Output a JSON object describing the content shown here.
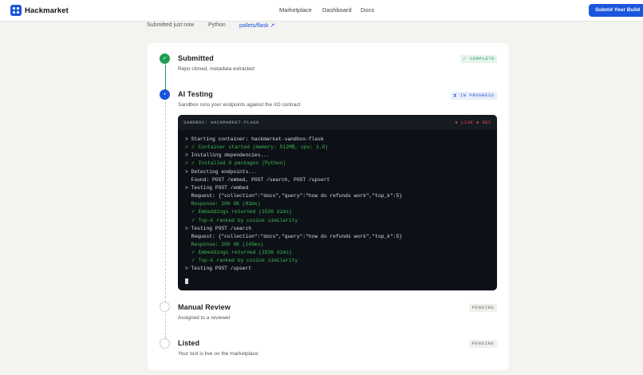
{
  "app": {
    "name": "Hackmarket"
  },
  "nav": {
    "items": [
      "Marketplace",
      "Dashboard",
      "Docs"
    ],
    "cta": "Submit Your Build"
  },
  "meta": {
    "submitted": "Submitted just now",
    "sep": "·",
    "language": "Python",
    "repo": "pallets/flask ↗"
  },
  "steps": [
    {
      "title": "Submitted",
      "desc": "Repo cloned, metadata extracted",
      "status": "✓ COMPLETE",
      "icon": "✓"
    },
    {
      "title": "AI Testing",
      "desc": "Sandbox runs your endpoints against the I/O contract",
      "status": "IN PROGRESS",
      "icon": "•"
    },
    {
      "title": "Manual Review",
      "desc": "Assigned to a reviewer",
      "status": "PENDING",
      "icon": ""
    },
    {
      "title": "Listed",
      "desc": "Your tool is live on the marketplace",
      "status": "PENDING",
      "icon": ""
    }
  ],
  "terminal": {
    "title": "SANDBOX: HACKMARKET-FLASK",
    "flags": "● LIVE  ● REC",
    "lines": [
      {
        "text": "> Starting container: hackmarket-sandbox-flask",
        "ok": false
      },
      {
        "text": "> ✓ Container started (memory: 512MB, cpu: 1.0)",
        "ok": true
      },
      {
        "text": "> Installing dependencies...",
        "ok": false
      },
      {
        "text": "> ✓ Installed 0 packages (Python)",
        "ok": true
      },
      {
        "text": "> Detecting endpoints...",
        "ok": false
      },
      {
        "text": "  Found: POST /embed, POST /search, POST /upsert",
        "ok": false
      },
      {
        "text": "> Testing POST /embed",
        "ok": false
      },
      {
        "text": "  Request: {\"collection\":\"docs\",\"query\":\"how do refunds work\",\"top_k\":5}",
        "ok": false
      },
      {
        "text": "  Response: 200 OK (91ms)",
        "ok": true
      },
      {
        "text": "  ✓ Embeddings returned (1536 dims)",
        "ok": true
      },
      {
        "text": "  ✓ Top-k ranked by cosine similarity",
        "ok": true
      },
      {
        "text": "> Testing POST /search",
        "ok": false
      },
      {
        "text": "  Request: {\"collection\":\"docs\",\"query\":\"how do refunds work\",\"top_k\":5}",
        "ok": false
      },
      {
        "text": "  Response: 200 OK (145ms)",
        "ok": true
      },
      {
        "text": "  ✓ Embeddings returned (1536 dims)",
        "ok": true
      },
      {
        "text": "  ✓ Top-k ranked by cosine similarity",
        "ok": true
      },
      {
        "text": "> Testing POST /upsert",
        "ok": false
      }
    ]
  },
  "colors": {
    "accent": "#1a56db",
    "success": "#1f9d55",
    "terminal_bg": "#0d1117"
  }
}
